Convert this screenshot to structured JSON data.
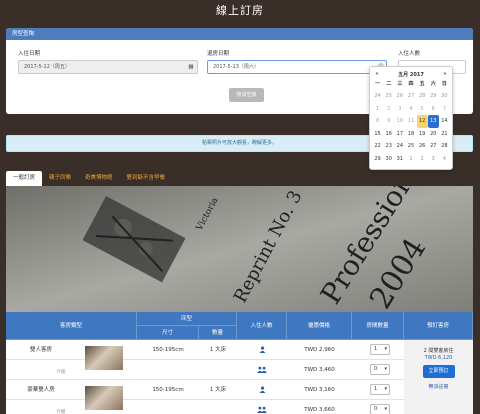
{
  "page": {
    "title": "線上訂房"
  },
  "search": {
    "panel_title": "房型查詢",
    "checkin_label": "入住日期",
    "checkin_value": "2017-5-12（周五）",
    "checkout_label": "退房日期",
    "checkout_value": "2017-5-13（周六）",
    "guests_label": "入住人數",
    "search_button": "搜尋空房"
  },
  "calendar": {
    "prev": "«",
    "month": "五月 2017",
    "next": "»",
    "weekdays": [
      "一",
      "二",
      "三",
      "四",
      "五",
      "六",
      "日"
    ],
    "rows": [
      [
        "24",
        "25",
        "26",
        "27",
        "28",
        "29",
        "30"
      ],
      [
        "1",
        "2",
        "3",
        "4",
        "5",
        "6",
        "7"
      ],
      [
        "8",
        "9",
        "10",
        "11",
        "12",
        "13",
        "14"
      ],
      [
        "15",
        "16",
        "17",
        "18",
        "19",
        "20",
        "21"
      ],
      [
        "22",
        "23",
        "24",
        "25",
        "26",
        "27",
        "28"
      ],
      [
        "29",
        "30",
        "31",
        "1",
        "2",
        "3",
        "4"
      ]
    ],
    "today": "12",
    "selected": "13"
  },
  "notice": "點擊照片可放大觀看，瞭解更多。",
  "tabs": [
    "一般訂房",
    "親子同樂",
    "奇美博物館",
    "雙到斷不含早餐"
  ],
  "hero": {
    "line1": "Victoria",
    "line2": "Reprint No. 3",
    "line3": "Profession",
    "line4": "2004"
  },
  "table": {
    "headers": {
      "room_type": "客房類型",
      "bed": "床型",
      "size": "尺寸",
      "qty": "數量",
      "guests": "入住人數",
      "price": "優惠價格",
      "rooms": "房間數量",
      "book": "預訂客房"
    },
    "rows": [
      {
        "name": "雙人客房",
        "small": "",
        "size": "150-195cm",
        "bed": "1 大床",
        "price": "TWD 2,960",
        "count": "1"
      },
      {
        "name": "",
        "small": "介紹",
        "size": "",
        "bed": "",
        "price": "TWD 3,460",
        "count": "0"
      },
      {
        "name": "豪華雙人房",
        "small": "",
        "size": "150-195cm",
        "bed": "1 大床",
        "price": "TWD 3,160",
        "count": "1"
      },
      {
        "name": "",
        "small": "介紹",
        "size": "",
        "bed": "",
        "price": "TWD 3,660",
        "count": "0"
      }
    ],
    "availability": "2 間雙客房住",
    "total": "TWD 6,120",
    "book_button": "立即預訂",
    "no_cancel": "無派註冊"
  }
}
